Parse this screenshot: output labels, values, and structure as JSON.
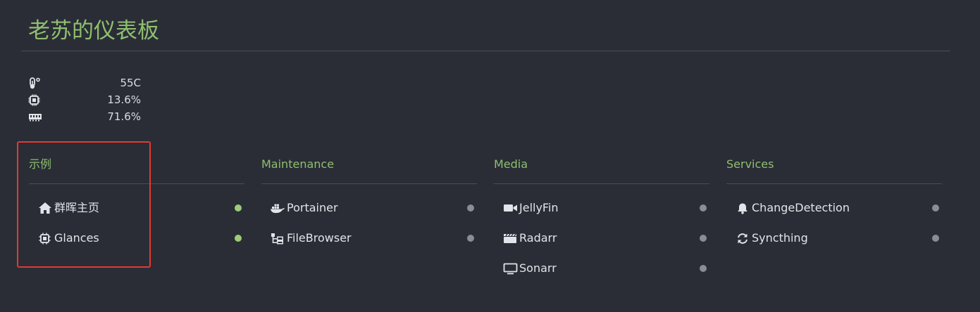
{
  "dashboard": {
    "title": "老苏的仪表板"
  },
  "stats": [
    {
      "icon": "thermometer-icon",
      "value": "55C"
    },
    {
      "icon": "cpu-icon",
      "value": "13.6%"
    },
    {
      "icon": "memory-icon",
      "value": "71.6%"
    }
  ],
  "groups": [
    {
      "title": "示例",
      "items": [
        {
          "label": "群晖主页",
          "icon": "home-icon",
          "status": "online"
        },
        {
          "label": "Glances",
          "icon": "cpu-icon",
          "status": "online"
        }
      ]
    },
    {
      "title": "Maintenance",
      "items": [
        {
          "label": "Portainer",
          "icon": "docker-icon",
          "status": "unknown"
        },
        {
          "label": "FileBrowser",
          "icon": "folder-tree-icon",
          "status": "unknown"
        }
      ]
    },
    {
      "title": "Media",
      "items": [
        {
          "label": "JellyFin",
          "icon": "video-camera-icon",
          "status": "unknown"
        },
        {
          "label": "Radarr",
          "icon": "clapperboard-icon",
          "status": "unknown"
        },
        {
          "label": "Sonarr",
          "icon": "tv-icon",
          "status": "unknown"
        }
      ]
    },
    {
      "title": "Services",
      "items": [
        {
          "label": "ChangeDetection",
          "icon": "bell-icon",
          "status": "unknown"
        },
        {
          "label": "Syncthing",
          "icon": "sync-icon",
          "status": "unknown"
        }
      ]
    }
  ],
  "colors": {
    "accent": "#8fbf6f",
    "online": "#9ccc78",
    "unknown": "#8a8d93",
    "highlight": "#e43a30"
  }
}
